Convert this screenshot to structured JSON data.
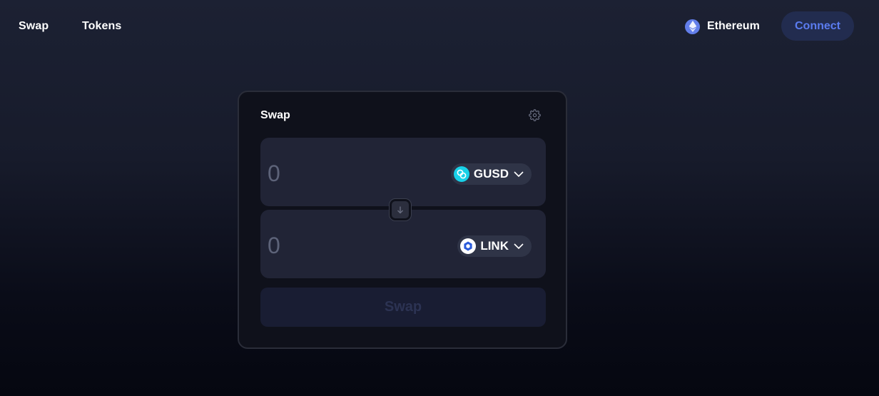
{
  "nav": {
    "swap_label": "Swap",
    "tokens_label": "Tokens"
  },
  "network": {
    "name": "Ethereum",
    "icon": "ethereum-icon",
    "color": "#627eea"
  },
  "connect": {
    "label": "Connect",
    "text_color": "#5b7cf0"
  },
  "card": {
    "title": "Swap",
    "settings_icon": "gear-icon"
  },
  "input_panel": {
    "amount_placeholder": "0",
    "token": {
      "symbol": "GUSD",
      "icon": "gusd-icon",
      "color": "#18d1e8"
    }
  },
  "output_panel": {
    "amount_placeholder": "0",
    "token": {
      "symbol": "LINK",
      "icon": "chainlink-icon",
      "color": "#2a5ada"
    }
  },
  "switch": {
    "icon": "arrow-down-icon"
  },
  "swap_button": {
    "label": "Swap",
    "disabled": true
  }
}
